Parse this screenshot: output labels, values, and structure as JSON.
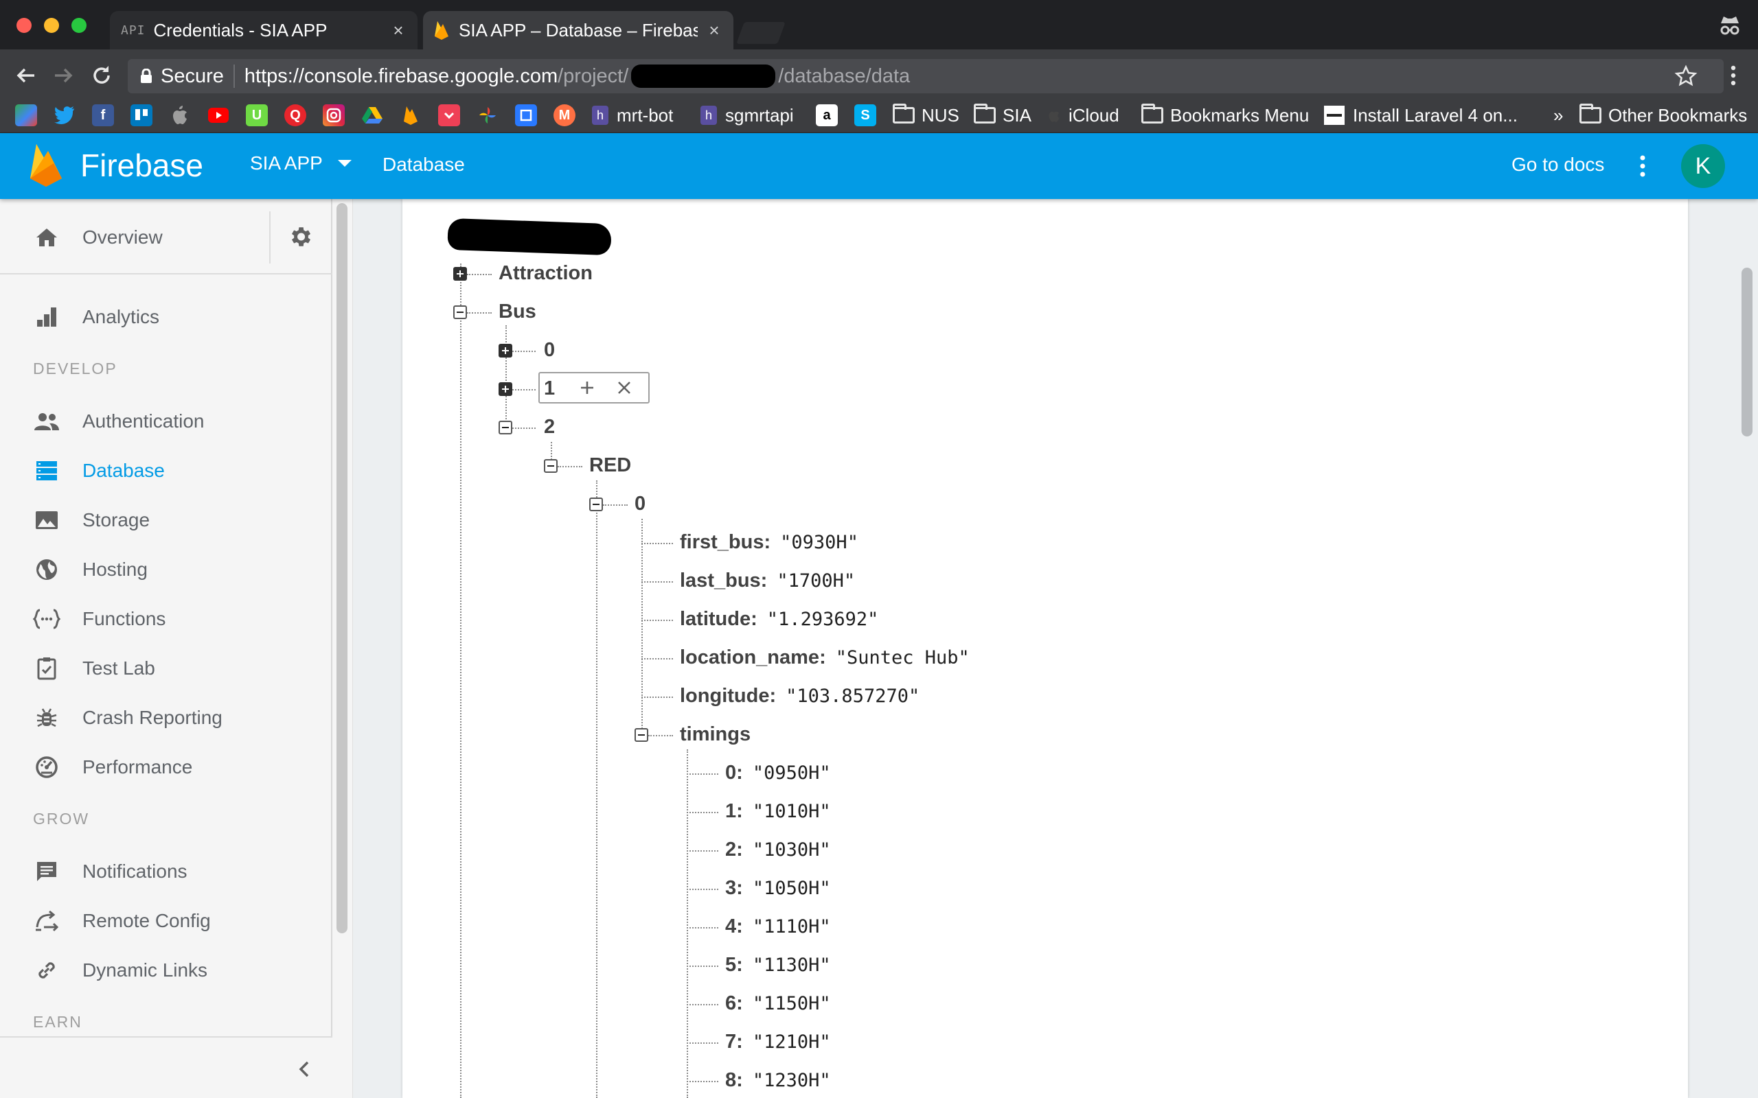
{
  "browser": {
    "tabs": [
      {
        "badge": "API",
        "title": "Credentials - SIA APP",
        "close": "×"
      },
      {
        "title": "SIA APP – Database – Firebase",
        "close": "×"
      }
    ],
    "secure_label": "Secure",
    "url_host": "https://console.firebase.google.com",
    "url_path_start": "/project/",
    "url_path_end": "/database/data",
    "bookmarks": [
      {
        "label": "mrt-bot"
      },
      {
        "label": "sgmrtapi"
      },
      {
        "label": "NUS"
      },
      {
        "label": "SIA"
      },
      {
        "label": "iCloud"
      },
      {
        "label": "Bookmarks Menu"
      },
      {
        "label": "Install Laravel 4 on..."
      },
      {
        "label": "Other Bookmarks"
      }
    ],
    "overflow": "»"
  },
  "appbar": {
    "product": "Firebase",
    "project": "SIA APP",
    "section": "Database",
    "docs_link": "Go to docs",
    "avatar_initial": "K"
  },
  "sidebar": {
    "overview": "Overview",
    "analytics": "Analytics",
    "develop_heading": "DEVELOP",
    "develop_items": [
      "Authentication",
      "Database",
      "Storage",
      "Hosting",
      "Functions",
      "Test Lab",
      "Crash Reporting",
      "Performance"
    ],
    "grow_heading": "GROW",
    "grow_items": [
      "Notifications",
      "Remote Config",
      "Dynamic Links"
    ],
    "earn_heading": "EARN",
    "active_item": "Database",
    "accent_color": "#039be5"
  },
  "tree": {
    "attraction": "Attraction",
    "bus": "Bus",
    "bus_children": [
      "0",
      "1",
      "2"
    ],
    "red": "RED",
    "red_child": "0",
    "fields": [
      {
        "key": "first_bus",
        "value": "\"0930H\""
      },
      {
        "key": "last_bus",
        "value": "\"1700H\""
      },
      {
        "key": "latitude",
        "value": "\"1.293692\""
      },
      {
        "key": "location_name",
        "value": "\"Suntec Hub\""
      },
      {
        "key": "longitude",
        "value": "\"103.857270\""
      }
    ],
    "timings_key": "timings",
    "timings": [
      {
        "key": "0",
        "value": "\"0950H\""
      },
      {
        "key": "1",
        "value": "\"1010H\""
      },
      {
        "key": "2",
        "value": "\"1030H\""
      },
      {
        "key": "3",
        "value": "\"1050H\""
      },
      {
        "key": "4",
        "value": "\"1110H\""
      },
      {
        "key": "5",
        "value": "\"1130H\""
      },
      {
        "key": "6",
        "value": "\"1150H\""
      },
      {
        "key": "7",
        "value": "\"1210H\""
      },
      {
        "key": "8",
        "value": "\"1230H\""
      }
    ]
  },
  "colors": {
    "appbar": "#039be5",
    "chrome_dark": "#202124",
    "avatar": "#009688"
  }
}
